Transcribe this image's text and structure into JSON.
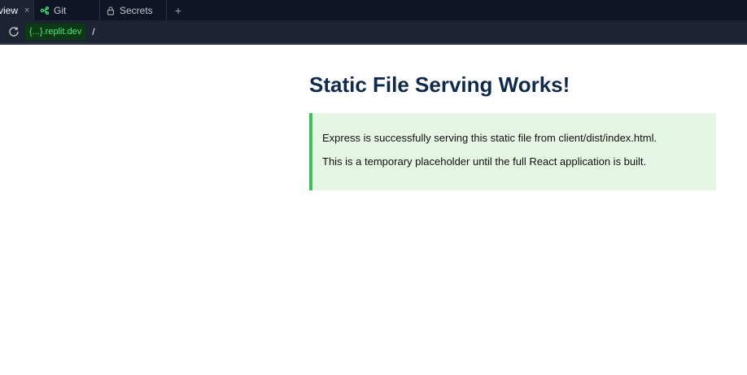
{
  "tabs": [
    {
      "label": "view",
      "close": "×"
    },
    {
      "label": "Git"
    },
    {
      "label": "Secrets"
    }
  ],
  "tab_add": "+",
  "url": {
    "badge": "{...}.replit.dev",
    "path": "/"
  },
  "page": {
    "title": "Static File Serving Works!",
    "notice_lines": [
      "Express is successfully serving this static file from client/dist/index.html.",
      "This is a temporary placeholder until the full React application is built."
    ]
  },
  "colors": {
    "tabbar_bg": "#0e1525",
    "urlbar_bg": "#1c2333",
    "url_badge_text": "#57e37f",
    "title": "#0f2a4a",
    "notice_bg": "#e6f6e4",
    "notice_border": "#3fc15a"
  },
  "icons": {
    "git_tab": "git-branch-icon",
    "secrets_tab": "lock-icon",
    "reload": "reload-icon"
  }
}
